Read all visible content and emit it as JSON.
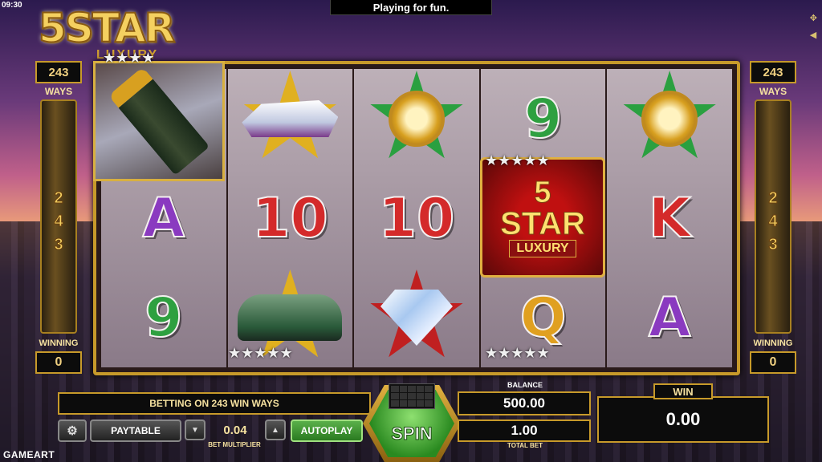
{
  "status": {
    "clock": "09:30",
    "banner": "Playing for fun."
  },
  "logo": {
    "title": "5STAR",
    "subtitle": "LUXURY"
  },
  "side_left": {
    "count": "243",
    "ways": "WAYS",
    "digits": [
      "2",
      "4",
      "3"
    ],
    "winning": "WINNING",
    "win_value": "0"
  },
  "side_right": {
    "count": "243",
    "ways": "WAYS",
    "digits": [
      "2",
      "4",
      "3"
    ],
    "winning": "WINNING",
    "win_value": "0"
  },
  "reels": [
    [
      "champagne",
      "A",
      "9"
    ],
    [
      "yacht",
      "10",
      "car"
    ],
    [
      "watch",
      "10",
      "diamond"
    ],
    [
      "9",
      "wild",
      "Q"
    ],
    [
      "watch",
      "K",
      "A"
    ]
  ],
  "wild": {
    "line1": "5",
    "line2": "STAR",
    "line3": "LUXURY"
  },
  "controls": {
    "betting_text": "BETTING ON 243 WIN WAYS",
    "paytable": "PAYTABLE",
    "bet_multiplier": "0.04",
    "bet_multiplier_label": "BET MULTIPLIER",
    "autoplay": "AUTOPLAY",
    "spin": "SPIN",
    "balance_label": "BALANCE",
    "balance": "500.00",
    "total_bet": "1.00",
    "total_bet_label": "TOTAL BET",
    "win_label": "WIN",
    "win": "0.00"
  },
  "footer": {
    "brand": "GAMEART"
  },
  "icons": {
    "fullscreen": "fullscreen-icon",
    "sound": "sound-icon",
    "settings": "gear-icon"
  },
  "colors": {
    "gold": "#c79a2a",
    "green": "#2a8a20",
    "red": "#d42a2a"
  }
}
